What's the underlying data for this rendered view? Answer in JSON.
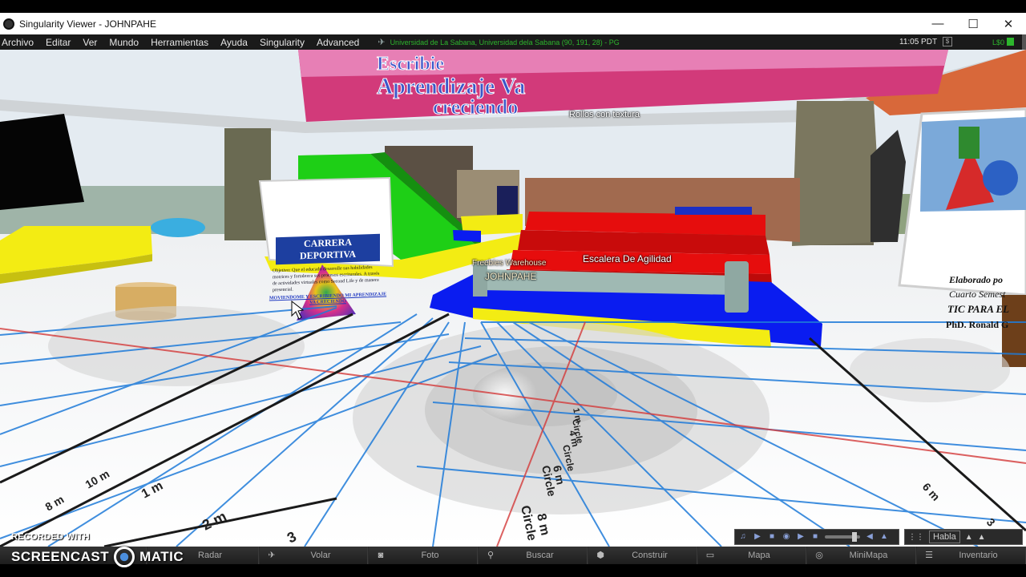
{
  "window": {
    "title": "Singularity Viewer - JOHNPAHE",
    "minimize": "—",
    "maximize": "☐",
    "close": "✕"
  },
  "menu": {
    "items": [
      "Archivo",
      "Editar",
      "Ver",
      "Mundo",
      "Herramientas",
      "Ayuda",
      "Singularity",
      "Advanced"
    ],
    "location": "Universidad de La Sabana, Universidad dela Sabana (90, 191, 28) - PG",
    "time": "11:05 PDT",
    "balance": "L$0"
  },
  "world": {
    "banner_lines": [
      "Escribie",
      "Aprendizaje Va",
      "creciendo"
    ],
    "labels": {
      "rollos": "Rollos con textura",
      "escalera": "Escalera De Agilidad",
      "freebies": "Freebies Warehouse",
      "avatar": "JOHNPAHE"
    },
    "sign_left": {
      "title": "CARRERA DEPORTIVA",
      "body": "Objetivo: Que el educado desarrolle sus habilidades motrices y fortalezca sus procesos escriturales. A través de actividades virtuales como Second Life y de manera presencial.",
      "link": "MOVIENDOME Y ESCRIBIENDO MI APRENDIZAJE VA CRECIENDO"
    },
    "sign_right": {
      "lines": [
        "Elaborado po",
        "Cuarto Semest",
        "TIC PARA EL",
        "PhD. Ronald G"
      ]
    },
    "floor_markings": [
      "1 m Circle",
      "4 m Circle",
      "6 m Circle",
      "8 m Circle",
      "1 m",
      "2 m",
      "3",
      "10 m",
      "1 m",
      "6 m",
      "3"
    ],
    "colors": {
      "yellow": "#f3ec13",
      "blue": "#0a1cf0",
      "red": "#e60d0d",
      "green": "#1ecf16",
      "grid_blue": "#1f7bd9",
      "grid_red": "#d43a3a"
    }
  },
  "status": {
    "hablar": "Habla",
    "media_icons": [
      "music-icon",
      "play-icon",
      "stop-icon",
      "media-icon",
      "play-icon",
      "stop-icon",
      "volume-icon",
      "up-icon"
    ],
    "voice_icons": [
      "gesture-icon",
      "speak-icon",
      "up-icon",
      "more-icon"
    ]
  },
  "toolbar": {
    "buttons": [
      {
        "label": "Radar",
        "icon": "radar-icon"
      },
      {
        "label": "Volar",
        "icon": "fly-icon"
      },
      {
        "label": "Foto",
        "icon": "camera-icon"
      },
      {
        "label": "Buscar",
        "icon": "search-icon"
      },
      {
        "label": "Construir",
        "icon": "build-icon"
      },
      {
        "label": "Mapa",
        "icon": "map-icon"
      },
      {
        "label": "MiniMapa",
        "icon": "minimap-icon"
      },
      {
        "label": "Inventario",
        "icon": "inventory-icon"
      }
    ]
  },
  "watermark": {
    "recorded": "RECORDED WITH",
    "word1": "SCREENCAST",
    "word2": "MATIC"
  }
}
